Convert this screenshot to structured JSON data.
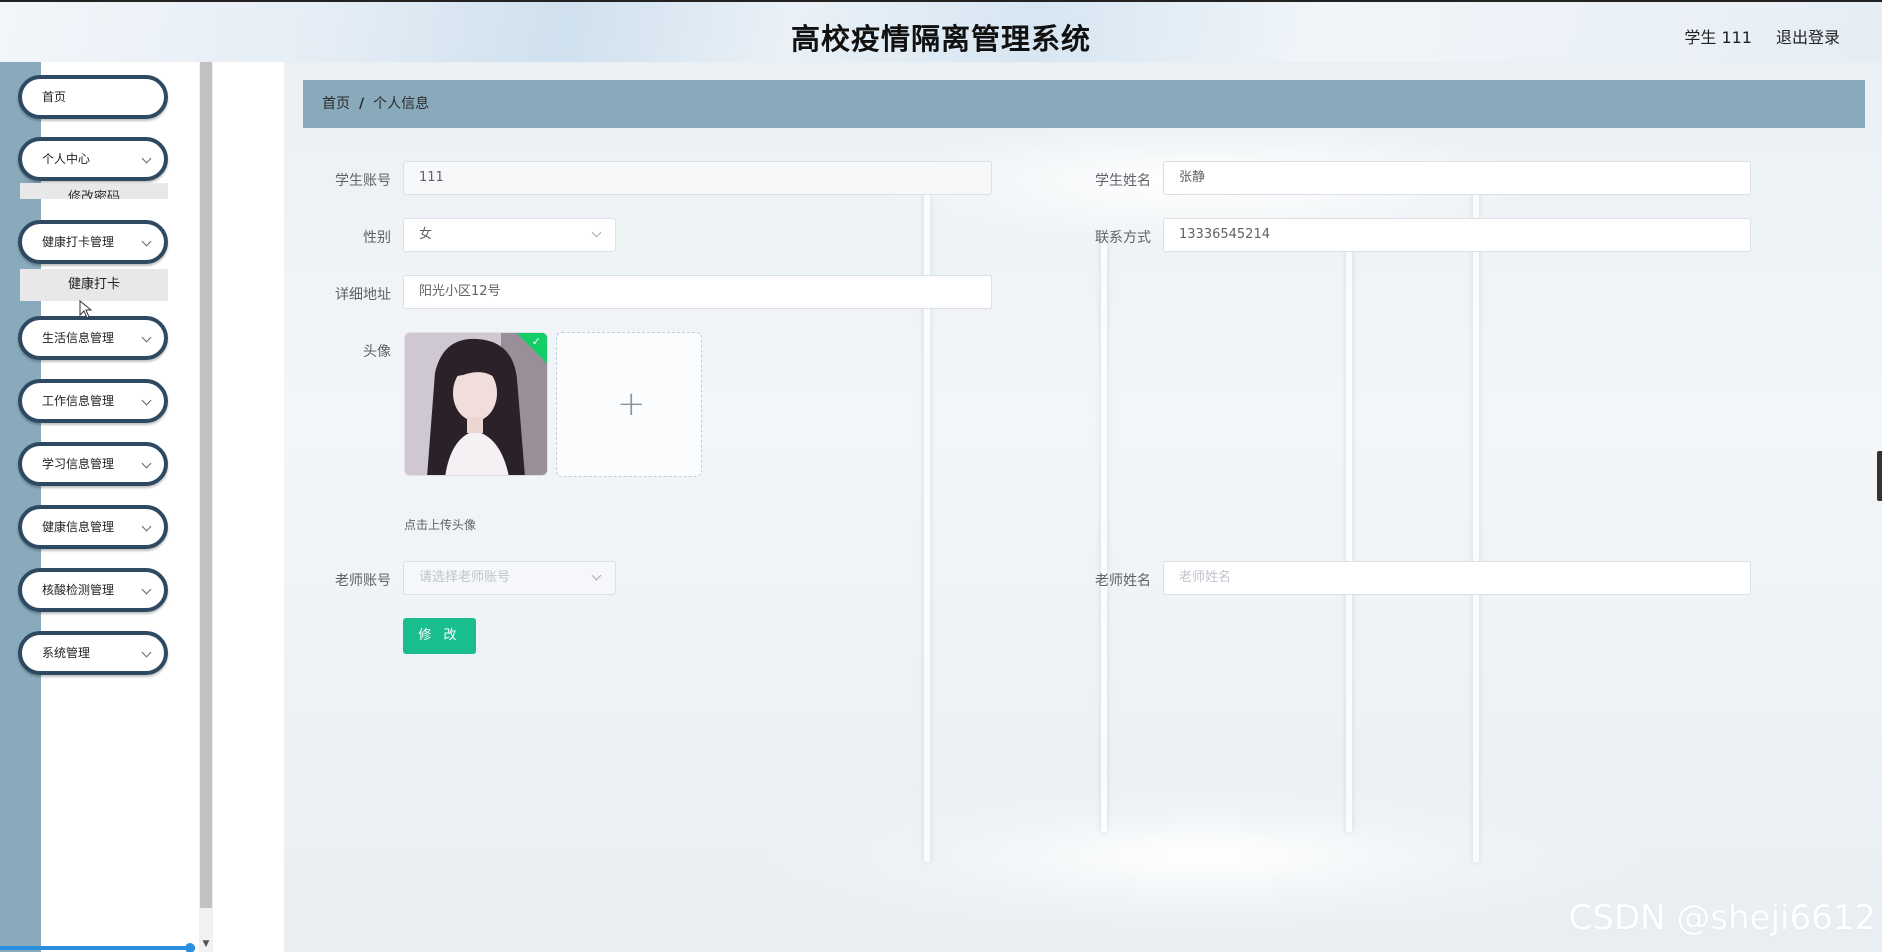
{
  "header": {
    "title": "高校疫情隔离管理系统",
    "user": "学生 111",
    "logout": "退出登录"
  },
  "sidebar": {
    "items": [
      {
        "label": "首页"
      },
      {
        "label": "个人中心"
      },
      {
        "label": "健康打卡管理"
      },
      {
        "label": "生活信息管理"
      },
      {
        "label": "工作信息管理"
      },
      {
        "label": "学习信息管理"
      },
      {
        "label": "健康信息管理"
      },
      {
        "label": "核酸检测管理"
      },
      {
        "label": "系统管理"
      }
    ],
    "sub_items": {
      "personal_center": "修改密码",
      "health_checkin": "健康打卡"
    }
  },
  "breadcrumb": {
    "home": "首页",
    "separator": "/",
    "current": "个人信息"
  },
  "form": {
    "student_account": {
      "label": "学生账号",
      "value": "111"
    },
    "student_name": {
      "label": "学生姓名",
      "value": "张静"
    },
    "gender": {
      "label": "性别",
      "value": "女"
    },
    "phone": {
      "label": "联系方式",
      "value": "13336545214"
    },
    "address": {
      "label": "详细地址",
      "value": "阳光小区12号"
    },
    "avatar": {
      "label": "头像",
      "tip": "点击上传头像"
    },
    "teacher_account": {
      "label": "老师账号",
      "placeholder": "请选择老师账号"
    },
    "teacher_name": {
      "label": "老师姓名",
      "placeholder": "老师姓名"
    },
    "submit": "修 改"
  },
  "watermark": "CSDN @sheji6612",
  "colors": {
    "sidebar_border": "#2e4a63",
    "breadcrumb_bg": "#88aabb",
    "submit_bg": "#19be8f",
    "success": "#13ce66"
  },
  "icons": {
    "menu_chevron": "chevron-down-icon",
    "upload": "plus-icon",
    "success": "check-icon"
  }
}
